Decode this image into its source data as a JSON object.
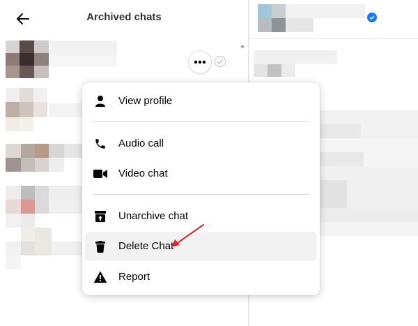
{
  "header": {
    "title": "Archived chats"
  },
  "menu": {
    "items": [
      {
        "label": "View profile",
        "icon": "person-icon"
      },
      {
        "label": "Audio call",
        "icon": "phone-icon"
      },
      {
        "label": "Video chat",
        "icon": "video-camera-icon"
      },
      {
        "label": "Unarchive chat",
        "icon": "unarchive-icon"
      },
      {
        "label": "Delete Chat",
        "icon": "trash-icon",
        "highlighted": true
      },
      {
        "label": "Report",
        "icon": "warning-icon"
      }
    ]
  },
  "colors": {
    "accent": "#1877f2",
    "annotation": "#d9262d",
    "hover": "#f2f2f2"
  }
}
